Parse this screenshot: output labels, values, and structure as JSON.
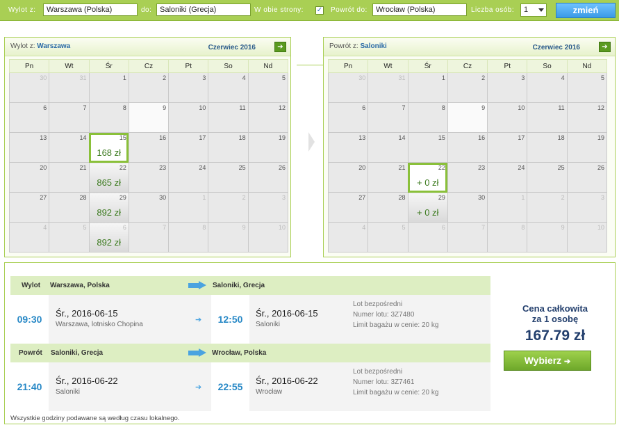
{
  "search": {
    "from_label": "Wylot z:",
    "from_value": "Warszawa (Polska)",
    "to_label": "do:",
    "to_value": "Saloniki (Grecja)",
    "both_ways_label": "W obie strony:",
    "both_ways_checked": "✓",
    "return_label": "Powrót do:",
    "return_value": "Wrocław (Polska)",
    "persons_label": "Liczba osób:",
    "persons_value": "1",
    "change_button": "zmień"
  },
  "outbound_calendar": {
    "label": "Wylot z:",
    "city": "Warszawa",
    "month": "Czerwiec 2016",
    "weekdays": [
      "Pn",
      "Wt",
      "Śr",
      "Cz",
      "Pt",
      "So",
      "Nd"
    ],
    "weeks": [
      [
        {
          "d": "30",
          "om": true
        },
        {
          "d": "31",
          "om": true
        },
        {
          "d": "1"
        },
        {
          "d": "2"
        },
        {
          "d": "3"
        },
        {
          "d": "4"
        },
        {
          "d": "5"
        }
      ],
      [
        {
          "d": "6"
        },
        {
          "d": "7"
        },
        {
          "d": "8"
        },
        {
          "d": "9",
          "nf": true
        },
        {
          "d": "10"
        },
        {
          "d": "11"
        },
        {
          "d": "12"
        }
      ],
      [
        {
          "d": "13"
        },
        {
          "d": "14"
        },
        {
          "d": "15",
          "price": "168 zł",
          "sel": true
        },
        {
          "d": "16"
        },
        {
          "d": "17"
        },
        {
          "d": "18"
        },
        {
          "d": "19"
        }
      ],
      [
        {
          "d": "20"
        },
        {
          "d": "21"
        },
        {
          "d": "22",
          "price": "865 zł"
        },
        {
          "d": "23"
        },
        {
          "d": "24"
        },
        {
          "d": "25"
        },
        {
          "d": "26"
        }
      ],
      [
        {
          "d": "27"
        },
        {
          "d": "28"
        },
        {
          "d": "29",
          "price": "892 zł"
        },
        {
          "d": "30"
        },
        {
          "d": "1",
          "om": true
        },
        {
          "d": "2",
          "om": true
        },
        {
          "d": "3",
          "om": true
        }
      ],
      [
        {
          "d": "4",
          "om": true
        },
        {
          "d": "5",
          "om": true
        },
        {
          "d": "6",
          "om": true,
          "price": "892 zł"
        },
        {
          "d": "7",
          "om": true
        },
        {
          "d": "8",
          "om": true
        },
        {
          "d": "9",
          "om": true
        },
        {
          "d": "10",
          "om": true
        }
      ]
    ]
  },
  "return_calendar": {
    "label": "Powrót z:",
    "city": "Saloniki",
    "month": "Czerwiec 2016",
    "weekdays": [
      "Pn",
      "Wt",
      "Śr",
      "Cz",
      "Pt",
      "So",
      "Nd"
    ],
    "weeks": [
      [
        {
          "d": "30",
          "om": true
        },
        {
          "d": "31",
          "om": true
        },
        {
          "d": "1"
        },
        {
          "d": "2"
        },
        {
          "d": "3"
        },
        {
          "d": "4"
        },
        {
          "d": "5"
        }
      ],
      [
        {
          "d": "6"
        },
        {
          "d": "7"
        },
        {
          "d": "8"
        },
        {
          "d": "9",
          "nf": true
        },
        {
          "d": "10"
        },
        {
          "d": "11"
        },
        {
          "d": "12"
        }
      ],
      [
        {
          "d": "13"
        },
        {
          "d": "14"
        },
        {
          "d": "15"
        },
        {
          "d": "16"
        },
        {
          "d": "17"
        },
        {
          "d": "18"
        },
        {
          "d": "19"
        }
      ],
      [
        {
          "d": "20"
        },
        {
          "d": "21"
        },
        {
          "d": "22",
          "price": "+ 0 zł",
          "sel": true
        },
        {
          "d": "23"
        },
        {
          "d": "24"
        },
        {
          "d": "25"
        },
        {
          "d": "26"
        }
      ],
      [
        {
          "d": "27"
        },
        {
          "d": "28"
        },
        {
          "d": "29",
          "price": "+ 0 zł"
        },
        {
          "d": "30"
        },
        {
          "d": "1",
          "om": true
        },
        {
          "d": "2",
          "om": true
        },
        {
          "d": "3",
          "om": true
        }
      ],
      [
        {
          "d": "4",
          "om": true
        },
        {
          "d": "5",
          "om": true
        },
        {
          "d": "6",
          "om": true
        },
        {
          "d": "7",
          "om": true
        },
        {
          "d": "8",
          "om": true
        },
        {
          "d": "9",
          "om": true
        },
        {
          "d": "10",
          "om": true
        }
      ]
    ]
  },
  "outbound": {
    "label": "Wylot",
    "from": "Warszawa, Polska",
    "to": "Saloniki, Grecja",
    "dep_time": "09:30",
    "dep_date": "Śr., 2016-06-15",
    "dep_place": "Warszawa, lotnisko Chopina",
    "arr_time": "12:50",
    "arr_date": "Śr., 2016-06-15",
    "arr_place": "Saloniki",
    "direct": "Lot bezpośredni",
    "flight_no": "Numer lotu: 3Z7480",
    "baggage": "Limit bagażu w cenie: 20 kg"
  },
  "return": {
    "label": "Powrót",
    "from": "Saloniki, Grecja",
    "to": "Wrocław, Polska",
    "dep_time": "21:40",
    "dep_date": "Śr., 2016-06-22",
    "dep_place": "Saloniki",
    "arr_time": "22:55",
    "arr_date": "Śr., 2016-06-22",
    "arr_place": "Wrocław",
    "direct": "Lot bezpośredni",
    "flight_no": "Numer lotu: 3Z7461",
    "baggage": "Limit bagażu w cenie: 20 kg"
  },
  "price": {
    "label_line1": "Cena całkowita",
    "label_line2": "za 1 osobę",
    "amount": "167.79 zł",
    "select_button": "Wybierz"
  },
  "note": "Wszystkie godziny podawane są według czasu lokalnego.",
  "colors": {
    "accent_green": "#a9cf54",
    "link_blue": "#2788c6",
    "price_green": "#3c7a1f"
  }
}
